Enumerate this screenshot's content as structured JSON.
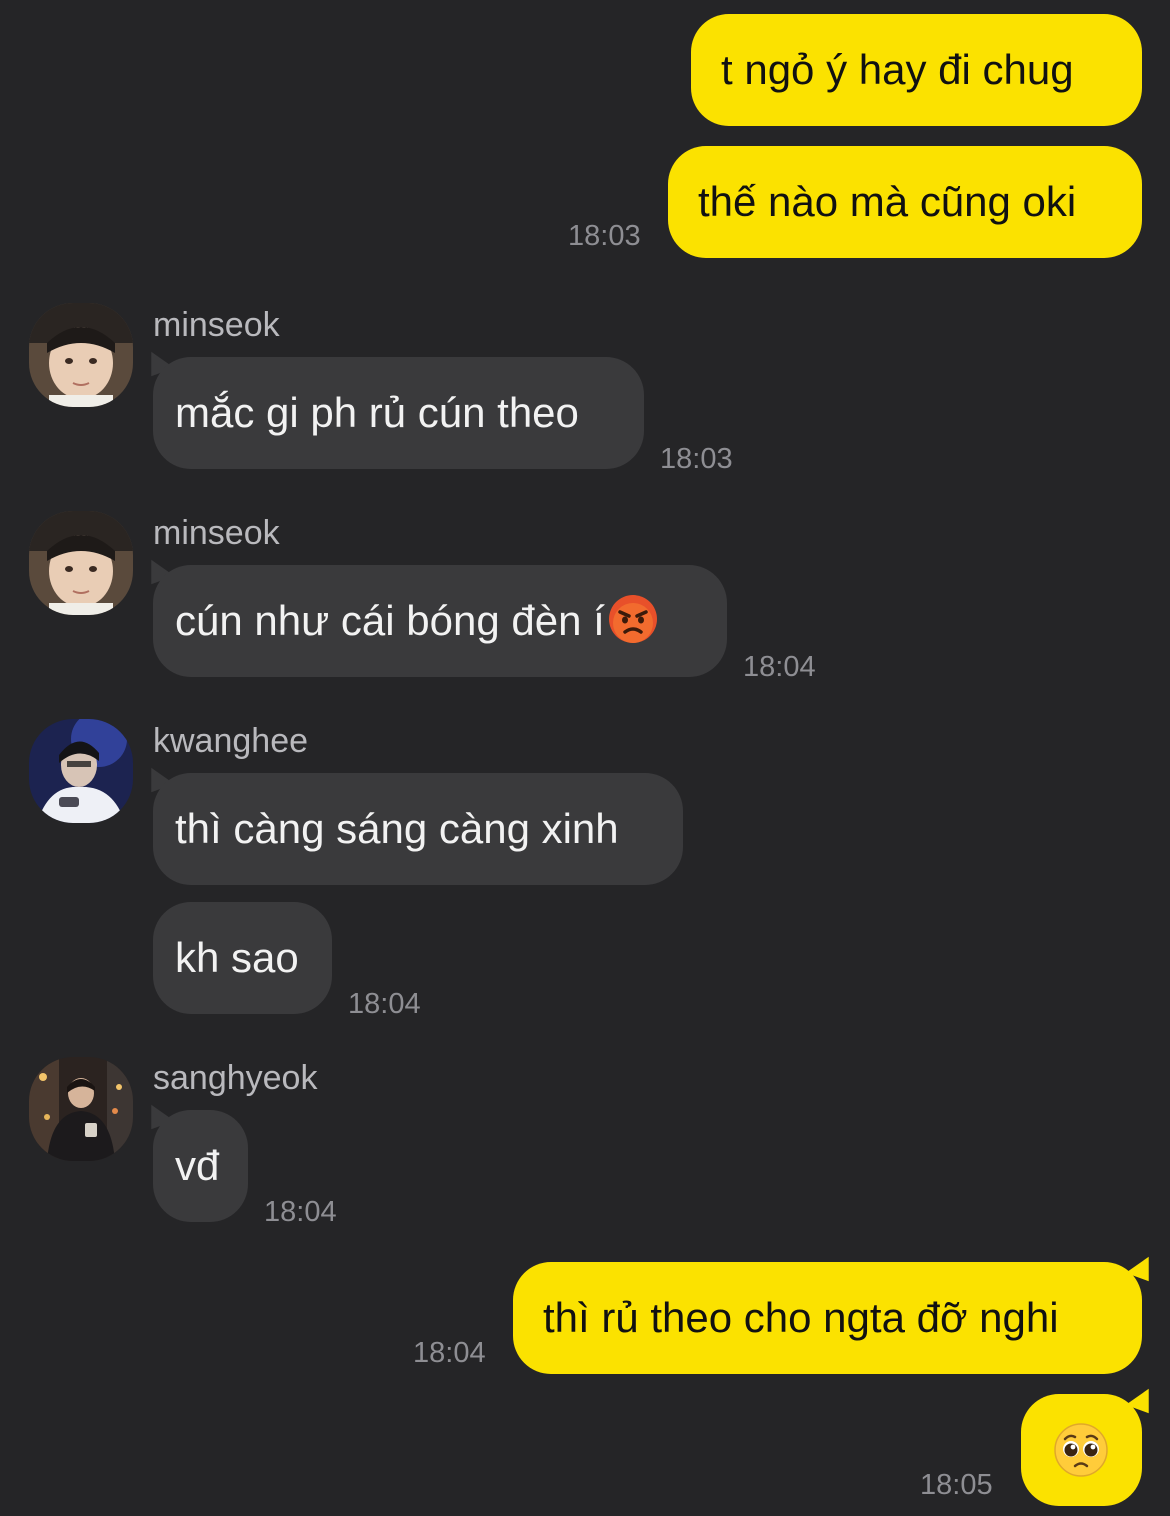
{
  "colors": {
    "background": "#252527",
    "outgoing_bubble": "#fbe200",
    "incoming_bubble": "#3a3a3c",
    "timestamp": "#8e8e93"
  },
  "messages": {
    "m1": {
      "text": "t ngỏ ý hay đi chug"
    },
    "m2": {
      "text": "thế nào mà cũng oki",
      "time": "18:03"
    },
    "g1": {
      "sender": "minseok",
      "text": "mắc gi ph rủ cún theo",
      "time": "18:03"
    },
    "g2": {
      "sender": "minseok",
      "text": "cún như cái bóng đèn í",
      "emoji": "angry-face-icon",
      "time": "18:04"
    },
    "g3": {
      "sender": "kwanghee",
      "text": "thì càng sáng càng xinh"
    },
    "g4": {
      "text": "kh sao",
      "time": "18:04"
    },
    "g5": {
      "sender": "sanghyeok",
      "text": "vđ",
      "time": "18:04"
    },
    "m3": {
      "text": "thì rủ theo cho ngta đỡ nghi",
      "time": "18:04"
    },
    "m4": {
      "emoji": "pleading-face-icon",
      "time": "18:05"
    }
  }
}
